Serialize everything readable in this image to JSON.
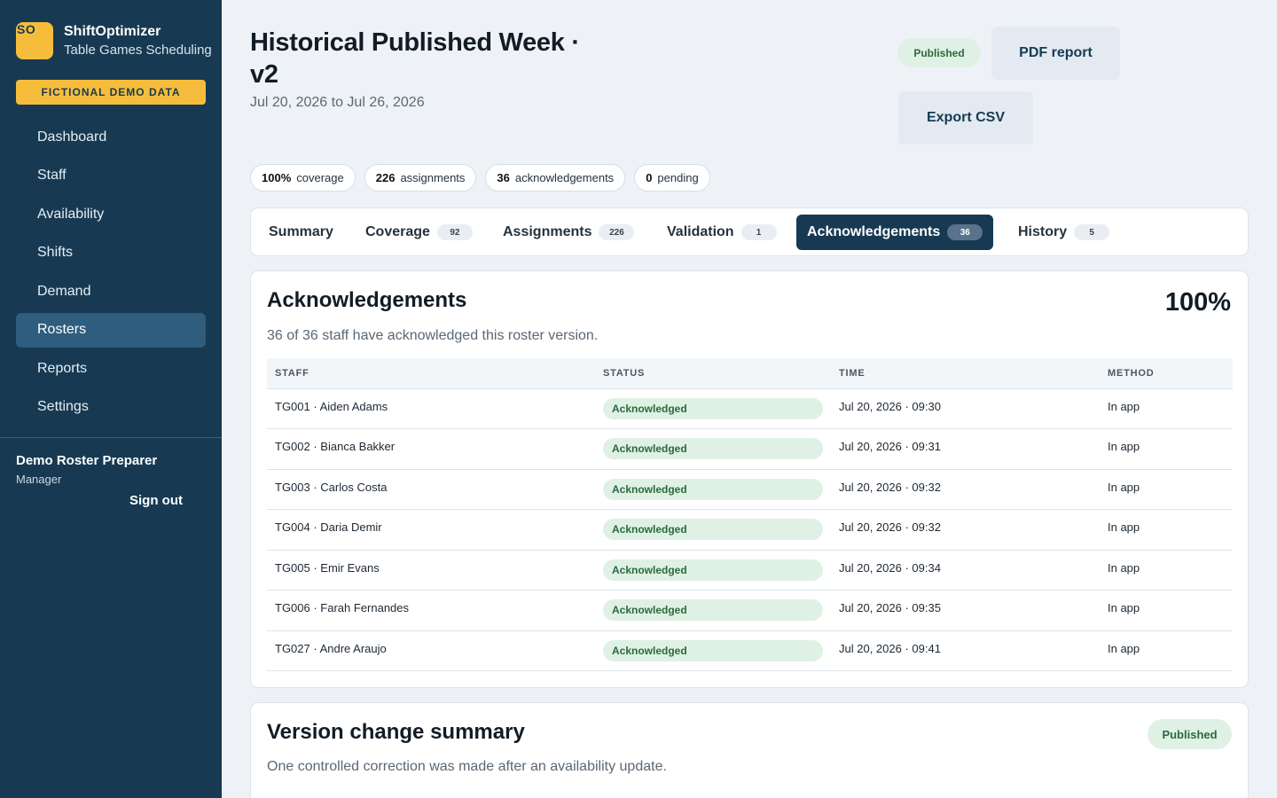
{
  "app": {
    "logo_text": "SO",
    "name": "ShiftOptimizer",
    "subtitle": "Table Games Scheduling",
    "demo_badge": "FICTIONAL DEMO DATA"
  },
  "nav": {
    "items": [
      {
        "label": "Dashboard"
      },
      {
        "label": "Staff"
      },
      {
        "label": "Availability"
      },
      {
        "label": "Shifts"
      },
      {
        "label": "Demand"
      },
      {
        "label": "Rosters"
      },
      {
        "label": "Reports"
      },
      {
        "label": "Settings"
      }
    ],
    "active": "Rosters"
  },
  "user": {
    "name": "Demo Roster Preparer",
    "role": "Manager",
    "signout": "Sign out"
  },
  "header": {
    "title": "Historical Published Week · v2",
    "date_range": "Jul 20, 2026 to Jul 26, 2026",
    "status_badge": "Published",
    "pdf_button": "PDF report",
    "csv_button": "Export CSV"
  },
  "stats": [
    {
      "value": "100%",
      "label": "coverage"
    },
    {
      "value": "226",
      "label": "assignments"
    },
    {
      "value": "36",
      "label": "acknowledgements"
    },
    {
      "value": "0",
      "label": "pending"
    }
  ],
  "tabs": [
    {
      "label": "Summary",
      "count": ""
    },
    {
      "label": "Coverage",
      "count": "92"
    },
    {
      "label": "Assignments",
      "count": "226"
    },
    {
      "label": "Validation",
      "count": "1"
    },
    {
      "label": "Acknowledgements",
      "count": "36"
    },
    {
      "label": "History",
      "count": "5"
    }
  ],
  "active_tab": "Acknowledgements",
  "ack": {
    "title": "Acknowledgements",
    "percent": "100%",
    "subtitle": "36 of 36 staff have acknowledged this roster version.",
    "columns": [
      "STAFF",
      "STATUS",
      "TIME",
      "METHOD"
    ],
    "rows": [
      {
        "staff": "TG001 · Aiden Adams",
        "status": "Acknowledged",
        "time": "Jul 20, 2026 · 09:30",
        "method": "In app"
      },
      {
        "staff": "TG002 · Bianca Bakker",
        "status": "Acknowledged",
        "time": "Jul 20, 2026 · 09:31",
        "method": "In app"
      },
      {
        "staff": "TG003 · Carlos Costa",
        "status": "Acknowledged",
        "time": "Jul 20, 2026 · 09:32",
        "method": "In app"
      },
      {
        "staff": "TG004 · Daria Demir",
        "status": "Acknowledged",
        "time": "Jul 20, 2026 · 09:32",
        "method": "In app"
      },
      {
        "staff": "TG005 · Emir Evans",
        "status": "Acknowledged",
        "time": "Jul 20, 2026 · 09:34",
        "method": "In app"
      },
      {
        "staff": "TG006 · Farah Fernandes",
        "status": "Acknowledged",
        "time": "Jul 20, 2026 · 09:35",
        "method": "In app"
      },
      {
        "staff": "TG027 · Andre Araujo",
        "status": "Acknowledged",
        "time": "Jul 20, 2026 · 09:41",
        "method": "In app"
      }
    ]
  },
  "version_summary": {
    "title": "Version change summary",
    "badge": "Published",
    "subtitle": "One controlled correction was made after an availability update."
  },
  "colors": {
    "sidebar": "#173a52",
    "accent": "#f6bd3c",
    "success_bg": "#dff1e4",
    "success_text": "#2a6a3d"
  }
}
